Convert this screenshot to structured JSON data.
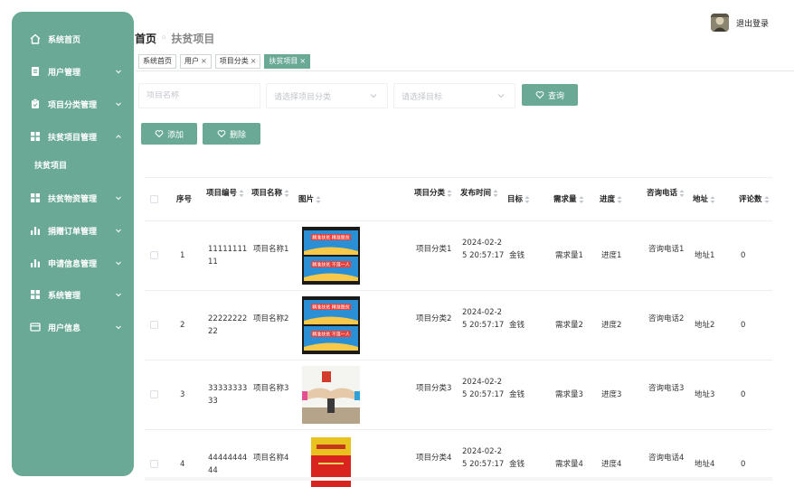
{
  "sidebar": {
    "items": [
      {
        "label": "系统首页",
        "icon": "home-icon",
        "expanded": false,
        "arrow": false
      },
      {
        "label": "用户管理",
        "icon": "user-icon",
        "expanded": false,
        "arrow": true
      },
      {
        "label": "项目分类管理",
        "icon": "clipboard-icon",
        "expanded": false,
        "arrow": true
      },
      {
        "label": "扶贫项目管理",
        "icon": "grid-icon",
        "expanded": true,
        "arrow": true
      },
      {
        "label": "扶贫物资管理",
        "icon": "grid-icon",
        "expanded": false,
        "arrow": true
      },
      {
        "label": "捐赠订单管理",
        "icon": "bar-chart-icon",
        "expanded": false,
        "arrow": true
      },
      {
        "label": "申请信息管理",
        "icon": "bar-chart-icon",
        "expanded": false,
        "arrow": true
      },
      {
        "label": "系统管理",
        "icon": "grid-icon",
        "expanded": false,
        "arrow": true
      },
      {
        "label": "用户信息",
        "icon": "card-icon",
        "expanded": false,
        "arrow": true
      }
    ],
    "sub_item": "扶贫项目"
  },
  "header": {
    "logout_label": "退出登录",
    "breadcrumb_home": "首页",
    "breadcrumb_sep": "◦",
    "breadcrumb_current": "扶贫项目"
  },
  "tags": [
    {
      "label": "系统首页",
      "closable": false,
      "active": false
    },
    {
      "label": "用户",
      "closable": true,
      "active": false
    },
    {
      "label": "项目分类",
      "closable": true,
      "active": false
    },
    {
      "label": "扶贫项目",
      "closable": true,
      "active": true
    }
  ],
  "tag_close_glyph": "×",
  "search": {
    "name_placeholder": "项目名称",
    "category_placeholder": "请选择项目分类",
    "target_placeholder": "请选择目标",
    "query_label": "查询"
  },
  "actions": {
    "add_label": "添加",
    "delete_label": "删除"
  },
  "table": {
    "columns": [
      "序号",
      "项目编号",
      "项目名称",
      "图片",
      "项目分类",
      "发布时间",
      "目标",
      "需求量",
      "进度",
      "咨询电话",
      "地址",
      "评论数"
    ],
    "rows": [
      {
        "index": "1",
        "code": "1111111111",
        "name": "项目名称1",
        "image": "poster",
        "category": "项目分类1",
        "time": "2024-02-25 20:57:17",
        "target": "金钱",
        "demand": "需求量1",
        "progress": "进度1",
        "phone": "咨询电话1",
        "address": "地址1",
        "comments": "0"
      },
      {
        "index": "2",
        "code": "2222222222",
        "name": "项目名称2",
        "image": "poster",
        "category": "项目分类2",
        "time": "2024-02-25 20:57:17",
        "target": "金钱",
        "demand": "需求量2",
        "progress": "进度2",
        "phone": "咨询电话2",
        "address": "地址2",
        "comments": "0"
      },
      {
        "index": "3",
        "code": "3333333333",
        "name": "项目名称3",
        "image": "hands",
        "category": "项目分类3",
        "time": "2024-02-25 20:57:17",
        "target": "金钱",
        "demand": "需求量3",
        "progress": "进度3",
        "phone": "咨询电话3",
        "address": "地址3",
        "comments": "0"
      },
      {
        "index": "4",
        "code": "4444444444",
        "name": "项目名称4",
        "image": "book",
        "category": "项目分类4",
        "time": "2024-02-25 20:57:17",
        "target": "金钱",
        "demand": "需求量4",
        "progress": "进度4",
        "phone": "咨询电话4",
        "address": "地址4",
        "comments": "0"
      }
    ],
    "poster_text_top": "精准扶贫 精准脱贫",
    "poster_text_bottom": "精准扶贫 不落一人"
  },
  "colors": {
    "accent": "#6aa996",
    "text": "#333333"
  }
}
